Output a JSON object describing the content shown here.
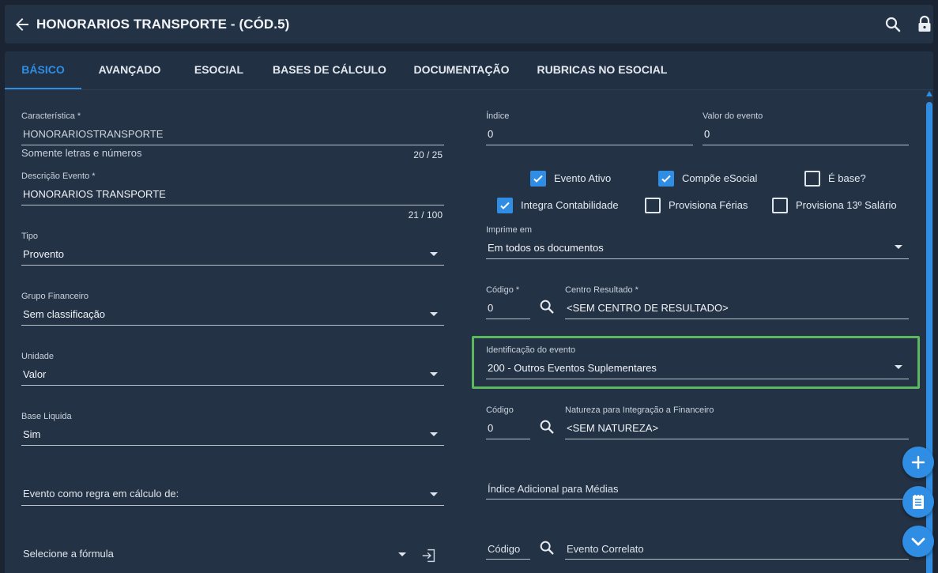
{
  "header": {
    "title": "HONORARIOS TRANSPORTE - (CÓD.5)"
  },
  "tabs": [
    {
      "label": "BÁSICO",
      "active": true
    },
    {
      "label": "AVANÇADO"
    },
    {
      "label": "ESOCIAL"
    },
    {
      "label": "BASES DE CÁLCULO"
    },
    {
      "label": "DOCUMENTAÇÃO"
    },
    {
      "label": "RUBRICAS NO ESOCIAL"
    }
  ],
  "left": {
    "caracteristica": {
      "label": "Característica *",
      "value": "HONORARIOSTRANSPORTE",
      "hint": "Somente letras e números",
      "counter": "20 / 25"
    },
    "descricao": {
      "label": "Descrição Evento *",
      "value": "HONORARIOS TRANSPORTE",
      "counter": "21 / 100"
    },
    "tipo": {
      "label": "Tipo",
      "value": "Provento"
    },
    "grupo": {
      "label": "Grupo Financeiro",
      "value": "Sem classificação"
    },
    "unidade": {
      "label": "Unidade",
      "value": "Valor"
    },
    "base_liquida": {
      "label": "Base Liquida",
      "value": "Sim"
    },
    "evento_regra": {
      "placeholder": "Evento como regra em cálculo de:"
    },
    "formula": {
      "placeholder": "Selecione a fórmula"
    }
  },
  "right": {
    "indice": {
      "label": "Índice",
      "value": "0"
    },
    "valor_evento": {
      "label": "Valor do evento",
      "value": "0"
    },
    "checkboxes": {
      "evento_ativo": {
        "label": "Evento Ativo",
        "checked": true
      },
      "compoe_esocial": {
        "label": "Compõe eSocial",
        "checked": true
      },
      "e_base": {
        "label": "É base?",
        "checked": false
      },
      "integra_contabilidade": {
        "label": "Integra Contabilidade",
        "checked": true
      },
      "provisiona_ferias": {
        "label": "Provisiona Férias",
        "checked": false
      },
      "provisiona_13": {
        "label": "Provisiona 13º Salário",
        "checked": false
      }
    },
    "imprime_em": {
      "label": "Imprime em",
      "value": "Em todos os documentos"
    },
    "codigo_cr": {
      "label": "Código *",
      "value": "0"
    },
    "centro_resultado": {
      "label": "Centro Resultado *",
      "value": "<SEM CENTRO DE RESULTADO>"
    },
    "identificacao": {
      "label": "Identificação do evento",
      "value": "200 - Outros Eventos Suplementares"
    },
    "codigo_nat": {
      "label": "Código",
      "value": "0"
    },
    "natureza": {
      "label": "Natureza para Integração a Financeiro",
      "value": "<SEM NATUREZA>"
    },
    "indice_adicional": {
      "placeholder": "Índice Adicional para Médias"
    },
    "codigo_correlato": {
      "placeholder": "Código"
    },
    "evento_correlato": {
      "placeholder": "Evento Correlato"
    }
  },
  "colors": {
    "accent": "#2f8de4",
    "highlight": "#5cb85c",
    "background": "#1a2432",
    "surface": "#243245"
  }
}
